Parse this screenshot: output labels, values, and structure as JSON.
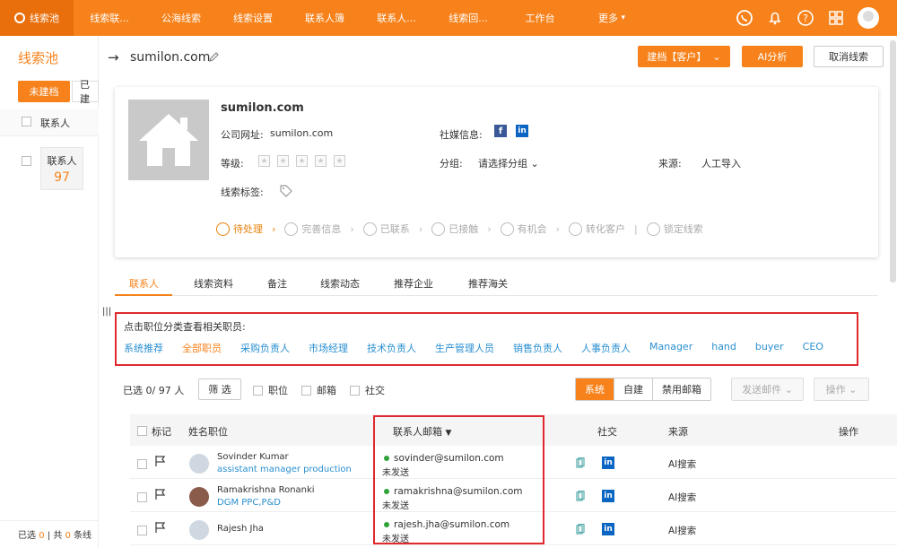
{
  "nav": {
    "tabs": [
      "线索池",
      "线索联...",
      "公海线索",
      "线索设置",
      "联系人簿",
      "联系人...",
      "线索回...",
      "工作台",
      "更多"
    ],
    "icons": [
      "whatsapp-icon",
      "bell-icon",
      "help-icon",
      "grid-icon",
      "user-avatar"
    ]
  },
  "left": {
    "title": "线索池",
    "tab_unarchived": "未建档",
    "tab_archived": "已建",
    "col_contact": "联系人",
    "contact_label": "联系人",
    "contact_count": "97",
    "footer_selected": "已选",
    "footer_sel_num": "0",
    "footer_sep": "|",
    "footer_total": "共",
    "footer_total_num": "0",
    "footer_tail": "条线"
  },
  "header": {
    "domain": "sumilon.com",
    "btn_archive": "建档【客户】",
    "btn_ai": "AI分析",
    "btn_cancel": "取消线索"
  },
  "card": {
    "company": "sumilon.com",
    "website_label": "公司网址:",
    "website": "sumilon.com",
    "social_label": "社媒信息:",
    "level_label": "等级:",
    "group_label": "分组:",
    "group_value": "请选择分组",
    "source_label": "来源:",
    "source_value": "人工导入",
    "tag_label": "线索标签:",
    "steps": [
      "待处理",
      "完善信息",
      "已联系",
      "已接触",
      "有机会",
      "转化客户",
      "锁定线索"
    ]
  },
  "tabs": [
    "联系人",
    "线索资料",
    "备注",
    "线索动态",
    "推荐企业",
    "推荐海关"
  ],
  "categories": {
    "hint": "点击职位分类查看相关职员:",
    "items": [
      "系统推荐",
      "全部职员",
      "采购负责人",
      "市场经理",
      "技术负责人",
      "生产管理人员",
      "销售负责人",
      "人事负责人",
      "Manager",
      "hand",
      "buyer",
      "CEO"
    ]
  },
  "filter": {
    "selected": "已选 0/ 97 人",
    "filter_btn": "筛 选",
    "chk_position": "职位",
    "chk_email": "邮箱",
    "chk_social": "社交",
    "seg": [
      "系统",
      "自建",
      "禁用邮箱"
    ],
    "send_btn": "发送邮件",
    "action_btn": "操作"
  },
  "table": {
    "headers": {
      "mark": "标记",
      "name": "姓名职位",
      "email": "联系人邮箱",
      "social": "社交",
      "source": "来源",
      "action": "操作"
    },
    "rows": [
      {
        "name": "Sovinder Kumar",
        "position": "assistant manager production",
        "email": "sovinder@sumilon.com",
        "status": "未发送",
        "source": "AI搜索"
      },
      {
        "name": "Ramakrishna Ronanki",
        "position": "DGM PPC,P&D",
        "email": "ramakrishna@sumilon.com",
        "status": "未发送",
        "source": "AI搜索"
      },
      {
        "name": "Rajesh Jha",
        "position": "",
        "email": "rajesh.jha@sumilon.com",
        "status": "未发送",
        "source": "AI搜索"
      }
    ]
  }
}
